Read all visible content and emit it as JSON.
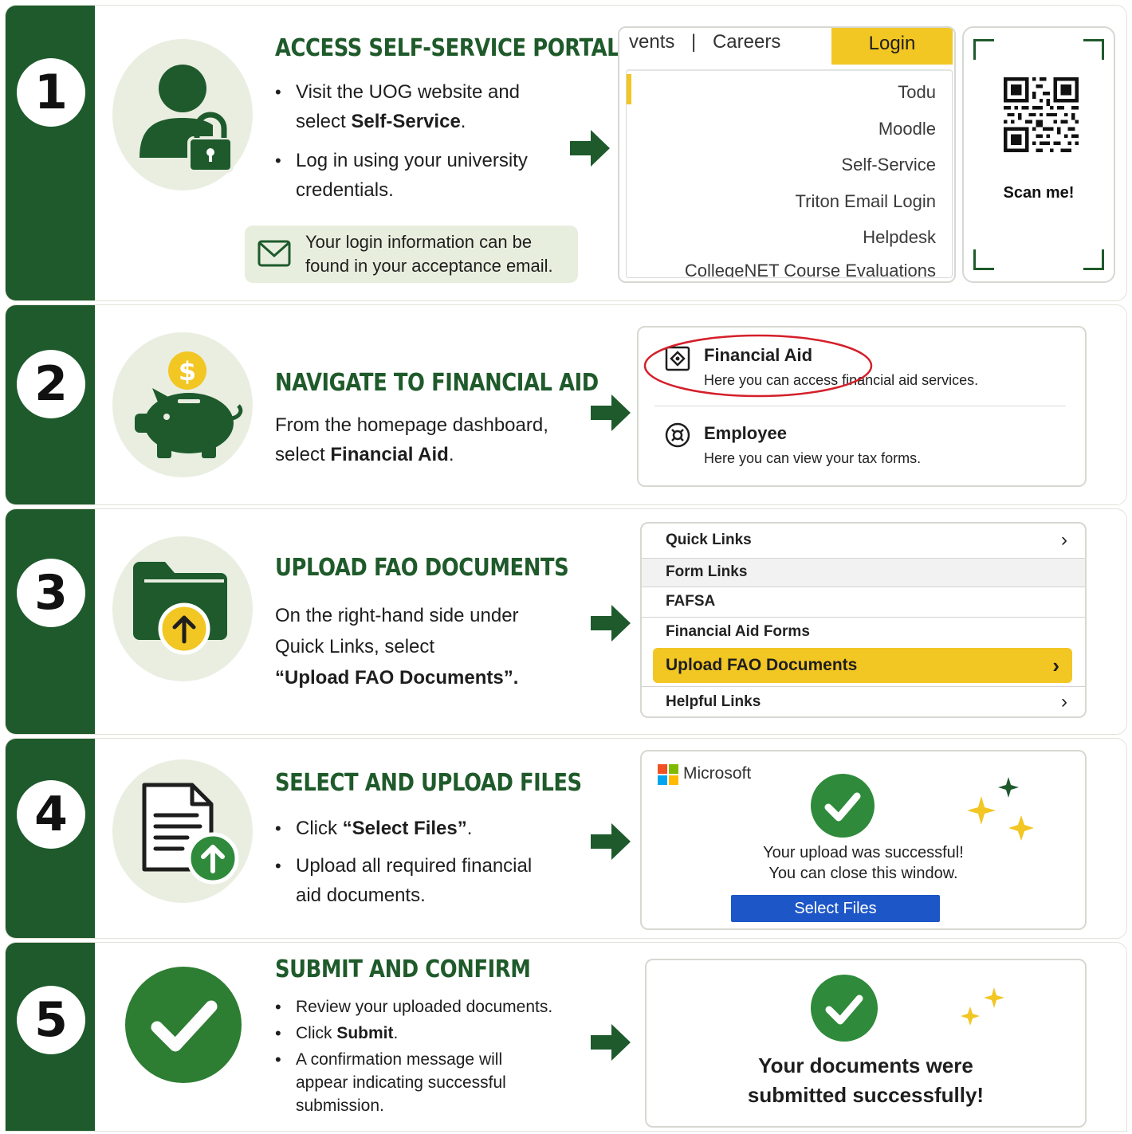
{
  "colors": {
    "brand_green": "#1e5a2c",
    "accent_yellow": "#f2c623",
    "button_blue": "#1d56c7",
    "highlight_red": "#d41f2a"
  },
  "steps": [
    {
      "number": "1",
      "title": "ACCESS SELF-SERVICE PORTAL",
      "icon": "user-lock-icon",
      "bullets": [
        {
          "pre": "Visit the UOG website and select ",
          "bold": "Self-Service",
          "post": "."
        },
        {
          "pre": "Log in using your university credentials.",
          "bold": "",
          "post": ""
        }
      ],
      "note": "Your login information can be found in your acceptance email.",
      "portal": {
        "nav_partial": "vents",
        "nav_separator": "|",
        "nav_careers": "Careers",
        "login": "Login",
        "menu": [
          "Todu",
          "Moodle",
          "Self-Service",
          "Triton Email Login",
          "Helpdesk",
          "CollegeNET Course Evaluations"
        ]
      },
      "qr_label": "Scan me!"
    },
    {
      "number": "2",
      "title": "NAVIGATE TO FINANCIAL AID",
      "icon": "piggy-bank-icon",
      "coin_symbol": "$",
      "desc_pre": "From the homepage dashboard, select ",
      "desc_bold": "Financial Aid",
      "desc_post": ".",
      "options": [
        {
          "title": "Financial Aid",
          "desc": "Here you can access financial aid services."
        },
        {
          "title": "Employee",
          "desc": "Here you can view your tax forms."
        }
      ]
    },
    {
      "number": "3",
      "title": "UPLOAD FAO DOCUMENTS",
      "icon": "folder-upload-icon",
      "desc_line1": "On the right-hand side under",
      "desc_line2": "Quick Links, select",
      "desc_bold": "“Upload FAO Documents”.",
      "quick_links": {
        "header": "Quick Links",
        "items": [
          "Form Links",
          "FAFSA",
          "Financial Aid Forms"
        ],
        "highlight": "Upload FAO Documents",
        "footer": "Helpful Links"
      }
    },
    {
      "number": "4",
      "title": "SELECT AND UPLOAD FILES",
      "icon": "document-upload-icon",
      "bullets": [
        {
          "pre": "Click ",
          "bold": "“Select Files”",
          "post": "."
        },
        {
          "pre": "Upload all required financial aid documents.",
          "bold": "",
          "post": ""
        }
      ],
      "ms_brand": "Microsoft",
      "success_line1": "Your upload was successful!",
      "success_line2": "You can close this window.",
      "button": "Select Files"
    },
    {
      "number": "5",
      "title": "SUBMIT AND CONFIRM",
      "icon": "checkmark-icon",
      "bullets": [
        {
          "pre": "Review your uploaded documents.",
          "bold": "",
          "post": ""
        },
        {
          "pre": "Click ",
          "bold": "Submit",
          "post": "."
        },
        {
          "pre": "A confirmation message will appear indicating successful submission.",
          "bold": "",
          "post": ""
        }
      ],
      "confirm_line1": "Your documents were",
      "confirm_line2": "submitted successfully!"
    }
  ]
}
